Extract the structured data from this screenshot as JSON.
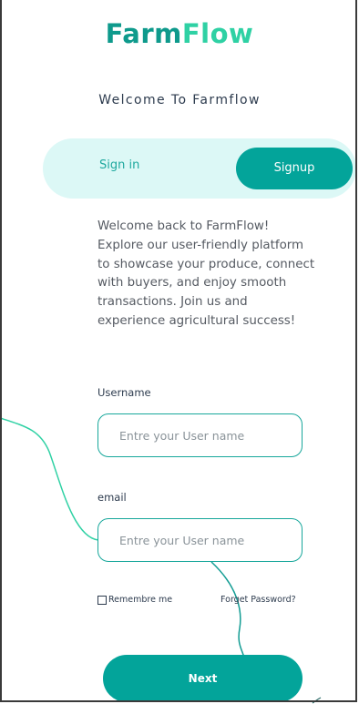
{
  "brand": {
    "name_part1": "Farm",
    "name_part2": "Flow",
    "color_primary": "#0e9a8c",
    "color_secondary": "#2fd1a4"
  },
  "welcome_title": "Welcome To Farmflow",
  "tabs": {
    "signin_label": "Sign in",
    "signup_label": "Signup",
    "active": "Signup"
  },
  "intro_text": "Welcome back to FarmFlow! Explore our user-friendly platform to showcase your produce, connect with buyers, and enjoy smooth transactions. Join us and experience agricultural success!",
  "form": {
    "username": {
      "label": "Username",
      "value": "",
      "placeholder": "Entre your User name"
    },
    "email": {
      "label": "email",
      "value": "",
      "placeholder": "Entre your User name"
    },
    "remember_label": "Remembre me",
    "remember_checked": false,
    "forgot_label": "Forget Password?",
    "submit_label": "Next"
  },
  "colors": {
    "accent": "#03a49a",
    "toggle_bg": "#dcf8f6",
    "decor_line": "#2fd1a4",
    "text_dark": "#2d3b4e"
  }
}
